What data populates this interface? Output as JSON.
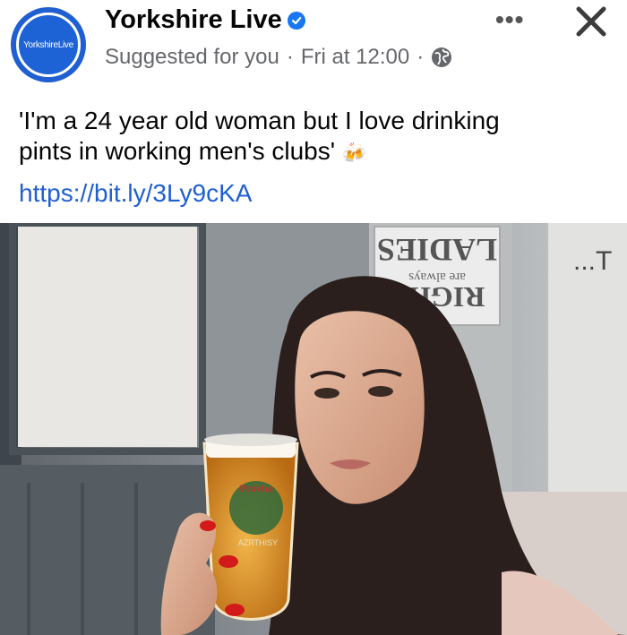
{
  "header": {
    "avatar_text": "YorkshireLive",
    "page_name": "Yorkshire Live",
    "subtitle": "Suggested for you",
    "separator": "·",
    "timestamp": "Fri at 12:00",
    "more_label": "•••",
    "close_label": "✕"
  },
  "post": {
    "text_line1": "'I'm a 24 year old woman but I love drinking",
    "text_line2": "pints in working men's clubs'",
    "emoji": "🍻",
    "link": "https://bit.ly/3Ly9cKA"
  },
  "photo": {
    "sign_text_1": "LADIES",
    "sign_text_2": "are always",
    "sign_text_3": "RIGHT",
    "sign_text_right": "...T",
    "glass_brand": "Pravha",
    "glass_sub": "AZRTHISY"
  },
  "colors": {
    "avatar_blue": "#1f5fd1",
    "verified_blue": "#1877f2",
    "link_blue": "#1f5fd1",
    "meta_gray": "#65676b"
  }
}
